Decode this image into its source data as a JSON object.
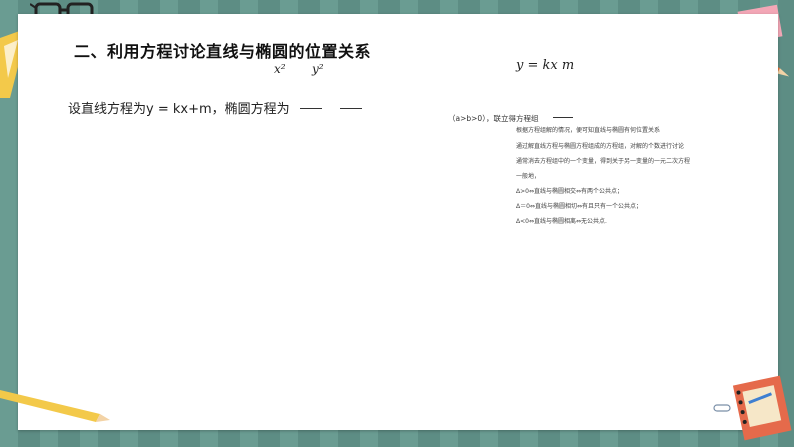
{
  "slide": {
    "title": "二、利用方程讨论直线与椭圆的位置关系",
    "intro": "设直线方程为y = kx+m，椭圆方程为",
    "line_equation": "kx  m",
    "condition": "（a>b>0），联立得方程组",
    "notes": [
      "根据方程组解的情况，便可知直线与椭圆有何位置关系",
      "通过解直线方程与椭圆方程组成的方程组，对解的个数进行讨论",
      "通常消去方程组中的一个变量，得到关于另一变量的一元二次方程",
      "一般地，",
      "Δ>0⇔直线与椭圆相交⇔有两个公共点；",
      "Δ＝0⇔直线与椭圆相切⇔有且只有一个公共点；",
      "Δ<0⇔直线与椭圆相离⇔无公共点."
    ]
  },
  "colors": {
    "background": "#5f8f86",
    "slide": "#ffffff"
  },
  "decorations": [
    "glasses-icon",
    "ruler-icon",
    "sticky-notes-icon",
    "pencil-icon",
    "notebook-icon",
    "paperclip-icon"
  ]
}
